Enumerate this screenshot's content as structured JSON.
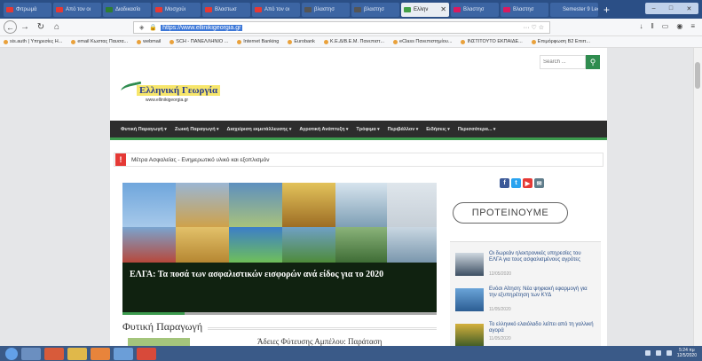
{
  "browser": {
    "tabs": [
      {
        "label": "Φιτρωμά",
        "color": "#e53935",
        "active": false
      },
      {
        "label": "Από τον οι",
        "color": "#e53935",
        "active": false
      },
      {
        "label": "Διαδικασίο",
        "color": "#2e7d32",
        "active": false
      },
      {
        "label": "Μοσχούι",
        "color": "#e53935",
        "active": false
      },
      {
        "label": "Βλαστωσ",
        "color": "#e53935",
        "active": false
      },
      {
        "label": "Από τον οι",
        "color": "#e53935",
        "active": false
      },
      {
        "label": "βλαστησ",
        "color": "#555555",
        "active": false
      },
      {
        "label": "βλαστησ",
        "color": "#555555",
        "active": false
      },
      {
        "label": "Ελλην",
        "color": "#43a047",
        "active": true
      },
      {
        "label": "Βλαστησ",
        "color": "#d81b60",
        "active": false
      },
      {
        "label": "Βλαστησ",
        "color": "#d81b60",
        "active": false
      },
      {
        "label": "Semester 9 Lec",
        "color": "#3c65a3",
        "active": false
      }
    ],
    "tab_close_glyph": "✕",
    "new_tab_glyph": "+",
    "url": "https://www.ellinikigeorgia.gr",
    "bookmarks": [
      "sis.auth | Υπηρεσίες Η...",
      "email Κωστας Παυσα...",
      "webmail",
      "SCH - ΠΑΝΕΛΛΗΝΙΟ ...",
      "Internet Banking",
      "Eurobank",
      "Κ.Ε.ΔΙΒ.Ε.Μ. Πανεπιστ...",
      "eClass Πανεπιστημίου...",
      "ΙΝΣΤΙΤΟΥΤΟ ΕΚΠΑΙΔΕ...",
      "Επιμόρφωση Β2 Επιπ..."
    ]
  },
  "site": {
    "search_placeholder": "Search ...",
    "logo_name": "Ελληνική Γεωργία",
    "logo_url": "www.ellinikigeorgia.gr",
    "menu": [
      "Φυτική Παραγωγή",
      "Ζωική Παραγωγή",
      "Διαχείριση εκμετάλλευσης",
      "Αγροτική Ανάπτυξη",
      "Τρόφιμα",
      "Περιβάλλον",
      "Ειδήσεις",
      "Περισσότερα..."
    ],
    "notice_icon": "!",
    "notice": "Μέτρα Ασφαλείας - Ενημερωτικό υλικό και εξοπλισμόν",
    "hero_caption": "ΕΛΓΑ: Τα ποσά των ασφαλιστικών εισφορών ανά είδος για το 2020",
    "section_title": "Φυτική Παραγωγή",
    "section_first_article": "Άδειες Φύτευσης Αμπέλου: Παράταση",
    "recommend": "ΠΡΟΤΕΙΝΟΥΜΕ",
    "social": [
      {
        "glyph": "f",
        "color": "#3b5998"
      },
      {
        "glyph": "t",
        "color": "#2aa3ef"
      },
      {
        "glyph": "▶",
        "color": "#e53935"
      },
      {
        "glyph": "✉",
        "color": "#607d8b"
      }
    ],
    "side_articles": [
      {
        "title": "Οι δωρεάν ηλεκτρονικές υπηρεσίες του ΕΛΓΑ για τους ασφαλισμένους αγρότες",
        "date": "12/05/2020"
      },
      {
        "title": "Ενόσι Αίτηση: Νέα ψηφιακή εφαρμογή για την εξυπηρέτηση των ΚΥΔ",
        "date": "11/05/2020"
      },
      {
        "title": "Το ελληνικό ελαιόλαδο λείπει από τη γαλλική αγορά",
        "date": "11/05/2020"
      }
    ]
  },
  "taskbar": {
    "time": "5:24 πμ",
    "date": "12/5/2020"
  }
}
